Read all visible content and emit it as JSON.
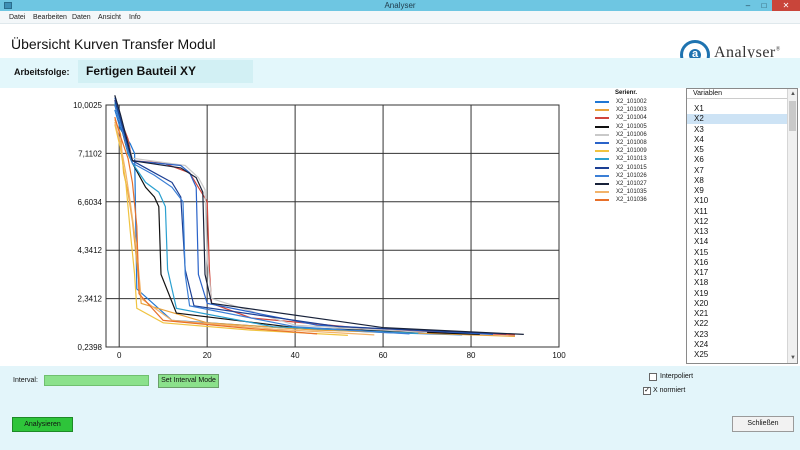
{
  "window": {
    "title": "Analyser"
  },
  "menu": [
    "Datei",
    "Bearbeiten",
    "Daten",
    "Ansicht",
    "Info"
  ],
  "header": {
    "title": "Übersicht Kurven Transfer Modul",
    "logo_text": "Analyser",
    "logo_reg": "®"
  },
  "workflow": {
    "label": "Arbeitsfolge:",
    "value": "Fertigen Bauteil XY"
  },
  "chart_data": {
    "type": "line",
    "y_ticks": [
      "10,0025",
      "7,1102",
      "6,6034",
      "4,3412",
      "2,3412",
      "0,2398"
    ],
    "x_ticks": [
      "0",
      "20",
      "40",
      "60",
      "80",
      "100"
    ],
    "xlim": [
      -3,
      100
    ],
    "legend_title": "Serienr.",
    "grid": true,
    "series": [
      {
        "name": "X2_101002",
        "color": "#1f77d4",
        "x": [
          -1,
          0.3,
          2.5,
          3,
          3.5,
          4,
          12,
          40,
          60,
          78
        ],
        "y": [
          4.9,
          4.5,
          4.2,
          4.1,
          4.0,
          1.2,
          0.55,
          0.38,
          0.3,
          0.25
        ]
      },
      {
        "name": "X2_101003",
        "color": "#e9a23b",
        "x": [
          -1,
          0.3,
          1,
          2,
          3,
          5,
          20,
          45,
          70,
          90
        ],
        "y": [
          4.7,
          4.4,
          3.6,
          3.2,
          2.6,
          0.9,
          0.5,
          0.35,
          0.28,
          0.22
        ]
      },
      {
        "name": "X2_101004",
        "color": "#d1453b",
        "x": [
          -1,
          0.3,
          2,
          3,
          10,
          16,
          18,
          20,
          20.5,
          21,
          30,
          60,
          90
        ],
        "y": [
          5.1,
          4.7,
          4.3,
          3.85,
          3.8,
          3.6,
          3.3,
          3.0,
          1.6,
          0.9,
          0.6,
          0.35,
          0.25
        ]
      },
      {
        "name": "X2_101005",
        "color": "#111111",
        "x": [
          -1,
          0.3,
          2,
          3,
          6,
          8,
          9,
          9.5,
          13,
          40,
          82
        ],
        "y": [
          5.0,
          4.6,
          4.0,
          3.8,
          3.3,
          3.1,
          2.9,
          1.5,
          0.7,
          0.4,
          0.26
        ]
      },
      {
        "name": "X2_101006",
        "color": "#c9c9c9",
        "x": [
          -1,
          0.3,
          2,
          3,
          15,
          18,
          19.5,
          20,
          21,
          40,
          70
        ],
        "y": [
          5.2,
          4.8,
          4.2,
          3.9,
          3.75,
          3.5,
          3.25,
          1.8,
          1.0,
          0.45,
          0.3
        ]
      },
      {
        "name": "X2_101008",
        "color": "#2a63c9",
        "x": [
          -1,
          0.3,
          2,
          3,
          14,
          16,
          17.5,
          18,
          20,
          45,
          85
        ],
        "y": [
          5.15,
          4.75,
          4.15,
          3.85,
          3.75,
          3.6,
          3.3,
          1.5,
          0.9,
          0.45,
          0.26
        ]
      },
      {
        "name": "X2_101009",
        "color": "#f0c340",
        "x": [
          -1,
          0.3,
          1.5,
          2.5,
          3.5,
          4,
          10,
          30,
          52
        ],
        "y": [
          4.6,
          4.1,
          3.4,
          2.4,
          1.5,
          0.8,
          0.5,
          0.35,
          0.24
        ]
      },
      {
        "name": "X2_101013",
        "color": "#2aa0d0",
        "x": [
          -1,
          0.3,
          2,
          3,
          6,
          9,
          10.5,
          11,
          13,
          35,
          68
        ],
        "y": [
          5.05,
          4.65,
          4.0,
          3.8,
          3.4,
          3.2,
          2.9,
          1.6,
          0.8,
          0.42,
          0.28
        ]
      },
      {
        "name": "X2_101015",
        "color": "#1c3f94",
        "x": [
          -1,
          0.3,
          2,
          3,
          8,
          12,
          14,
          15,
          17,
          50,
          88
        ],
        "y": [
          5.1,
          4.7,
          4.1,
          3.85,
          3.6,
          3.4,
          3.1,
          1.6,
          0.85,
          0.42,
          0.27
        ]
      },
      {
        "name": "X2_101026",
        "color": "#3b7fd6",
        "x": [
          -1,
          0.3,
          2,
          3,
          8,
          12,
          14.5,
          15,
          16,
          40,
          66
        ],
        "y": [
          5.0,
          4.6,
          4.05,
          3.8,
          3.55,
          3.3,
          3.0,
          1.5,
          0.85,
          0.42,
          0.27
        ]
      },
      {
        "name": "X2_101027",
        "color": "#18223a",
        "x": [
          -1,
          0.3,
          2,
          3,
          14,
          17.5,
          19,
          19.5,
          21,
          60,
          92
        ],
        "y": [
          5.2,
          4.8,
          4.2,
          3.85,
          3.7,
          3.5,
          3.2,
          1.5,
          0.9,
          0.4,
          0.26
        ]
      },
      {
        "name": "X2_101035",
        "color": "#f2b36a",
        "x": [
          -1,
          0.3,
          1.5,
          2.5,
          4,
          5,
          12,
          35,
          58
        ],
        "y": [
          4.65,
          4.2,
          3.6,
          3.0,
          2.0,
          1.0,
          0.55,
          0.37,
          0.25
        ]
      },
      {
        "name": "X2_101036",
        "color": "#e8702a",
        "x": [
          -1,
          0.3,
          2,
          3,
          4,
          4.5,
          10,
          30,
          45
        ],
        "y": [
          4.75,
          4.35,
          3.9,
          3.4,
          2.5,
          1.1,
          0.55,
          0.38,
          0.27
        ]
      }
    ]
  },
  "variables": {
    "header": "Variablen",
    "selected": "X2",
    "items": [
      "X1",
      "X2",
      "X3",
      "X4",
      "X5",
      "X6",
      "X7",
      "X8",
      "X9",
      "X10",
      "X11",
      "X12",
      "X13",
      "X14",
      "X15",
      "X16",
      "X17",
      "X18",
      "X19",
      "X20",
      "X21",
      "X22",
      "X23",
      "X24",
      "X25"
    ]
  },
  "bottom": {
    "interval_label": "Interval:",
    "interval_value": "",
    "set_interval_button": "Set Interval Mode",
    "interpoliert_label": "Interpoliert",
    "interpoliert_checked": false,
    "x_normiert_label": "X normiert",
    "x_normiert_checked": true,
    "analyse_button": "Analysieren",
    "close_button": "Schließen"
  },
  "colors": {
    "accent": "#6ec6e2",
    "band": "#e3f7fb",
    "green": "#2ec43a"
  }
}
